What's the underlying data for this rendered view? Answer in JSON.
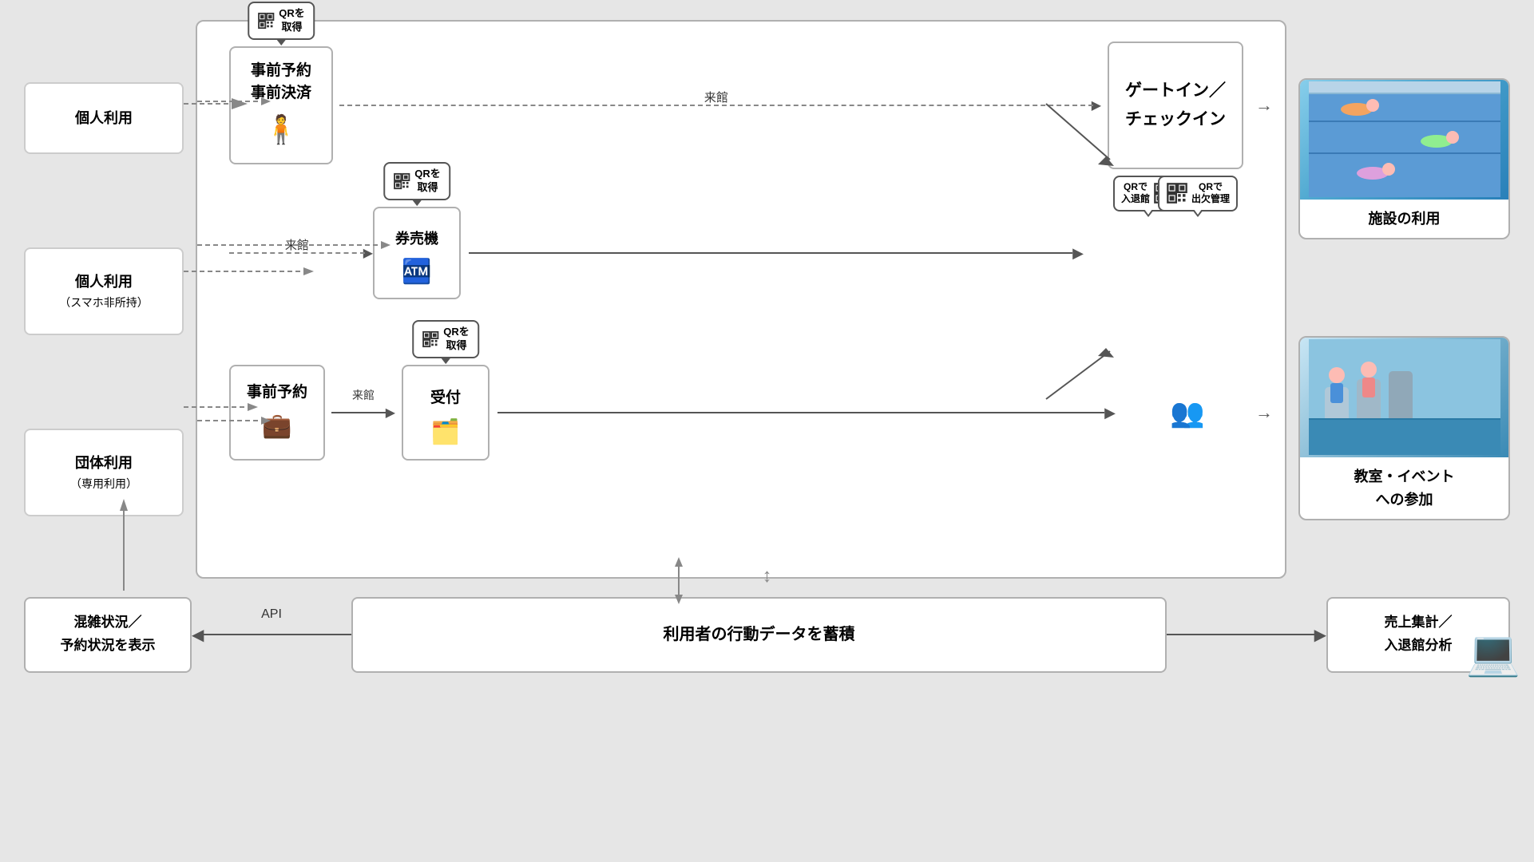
{
  "page": {
    "bg_color": "#e6e6e6"
  },
  "user_types": {
    "box1": "個人利用",
    "box2_line1": "個人利用",
    "box2_line2": "（スマホ非所持）",
    "box3_line1": "団体利用",
    "box3_line2": "（専用利用）"
  },
  "flow": {
    "row1": {
      "left_box_line1": "事前予約",
      "left_box_line2": "事前決済",
      "qr_label": "QRを",
      "qr_label2": "取得",
      "arrow_label": "来館",
      "gatein": "ゲートイン／\nチェックイン"
    },
    "row2": {
      "box": "券売機",
      "arrive_label": "来館",
      "qr_label": "QRを",
      "qr_label2": "取得"
    },
    "row3": {
      "box1": "事前予約",
      "arrive_label": "来館",
      "box2": "受付",
      "qr_label": "QRを",
      "qr_label2": "取得"
    },
    "qr_gate": "QRで\n入退館",
    "qr_attendance": "QRで\n出欠管理"
  },
  "outcomes": {
    "facility": "施設の利用",
    "class": "教室・イベント\nへの参加"
  },
  "bottom": {
    "left_box_line1": "混雑状況／",
    "left_box_line2": "予約状況を表示",
    "arrow_label": "API",
    "center_box": "利用者の行動データを蓄積",
    "right_box_line1": "売上集計／",
    "right_box_line2": "入退館分析"
  },
  "icons": {
    "qr": "qr-code",
    "arrow_right": "→",
    "arrow_left": "←",
    "arrow_down": "↓",
    "arrow_up": "↑"
  }
}
